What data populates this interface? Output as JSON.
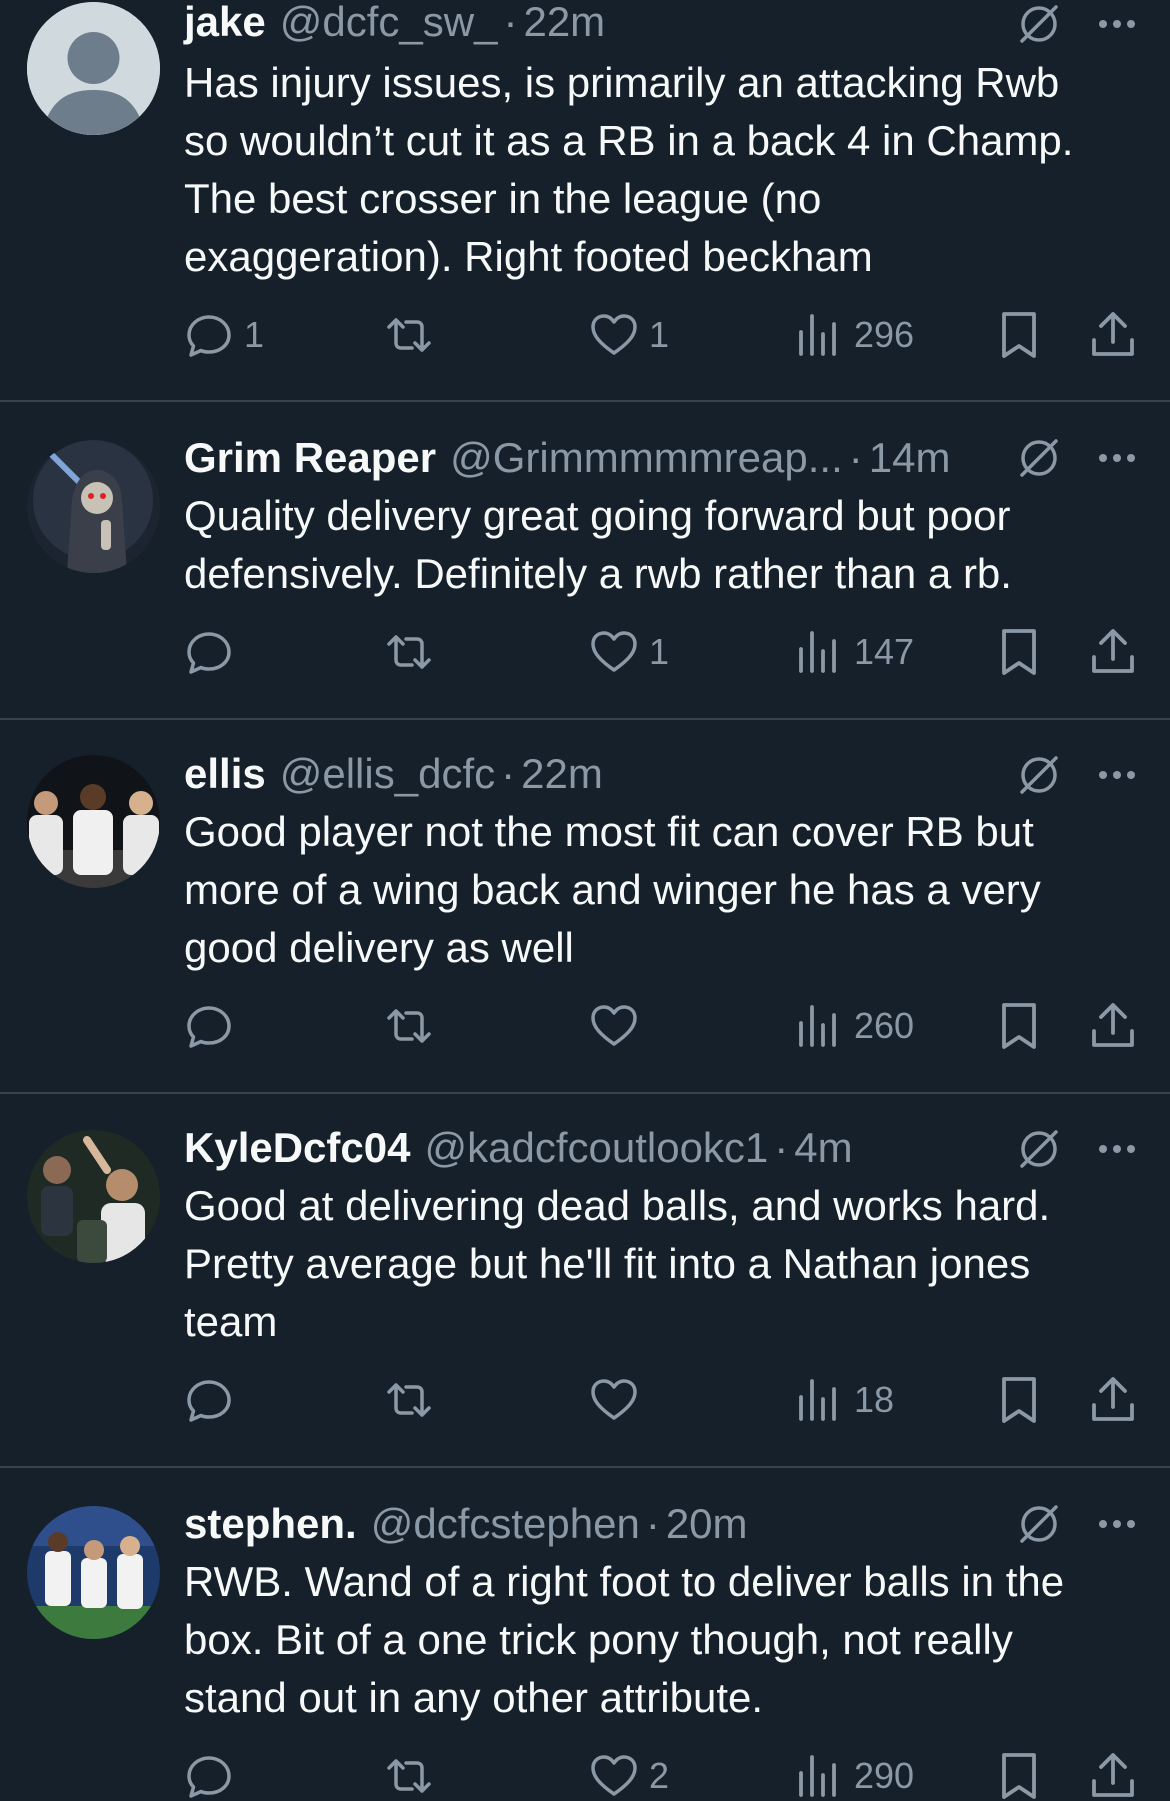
{
  "tweets": [
    {
      "name": "jake",
      "handle": "@dcfc_sw_",
      "dot": "·",
      "time": "22m",
      "text": "Has injury issues, is primarily an attacking Rwb\nso wouldn’t cut it as a RB in a back 4 in Champ.\nThe best crosser in the league (no\nexaggeration). Right footed beckham",
      "replies": "1",
      "retweets": "",
      "likes": "1",
      "views": "296"
    },
    {
      "name": "Grim Reaper",
      "handle": "@Grimmmmmreap...",
      "dot": "·",
      "time": "14m",
      "text": "Quality delivery great going forward but poor\ndefensively. Definitely a rwb rather than a rb.",
      "replies": "",
      "retweets": "",
      "likes": "1",
      "views": "147"
    },
    {
      "name": "ellis",
      "handle": "@ellis_dcfc",
      "dot": "·",
      "time": "22m",
      "text": "Good player not the most fit can cover RB but\nmore of a wing back and winger he has a very\ngood delivery as well",
      "replies": "",
      "retweets": "",
      "likes": "",
      "views": "260"
    },
    {
      "name": "KyleDcfc04",
      "handle": "@kadcfcoutlookc1",
      "dot": "·",
      "time": "4m",
      "text": "Good at delivering dead balls, and works hard.\nPretty average but he'll fit into a Nathan jones\nteam",
      "replies": "",
      "retweets": "",
      "likes": "",
      "views": "18"
    },
    {
      "name": "stephen.",
      "handle": "@dcfcstephen",
      "dot": "·",
      "time": "20m",
      "text": "RWB. Wand of a right foot to deliver balls in the\nbox. Bit of a one trick pony though, not really\nstand out in any other attribute.",
      "replies": "",
      "retweets": "",
      "likes": "2",
      "views": "290"
    }
  ],
  "icons": {
    "reply": "reply-icon",
    "retweet": "retweet-icon",
    "like": "heart-icon",
    "views": "views-icon",
    "bookmark": "bookmark-icon",
    "share": "share-icon",
    "grok": "grok-icon",
    "more": "more-icon"
  },
  "colors": {
    "background": "#15202b",
    "text": "#f7f9f9",
    "secondary": "#8b98a5",
    "divider": "#38444d"
  }
}
